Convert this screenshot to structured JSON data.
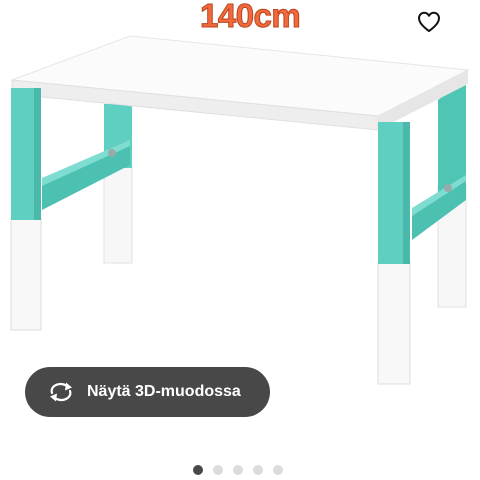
{
  "product": {
    "size_label": "140cm",
    "favorite_icon": "heart-outline-icon",
    "image_alt": "Desk with white top and turquoise adjustable legs"
  },
  "view3d": {
    "label": "Näytä 3D-muodossa",
    "icon": "rotate-arrows-icon"
  },
  "carousel": {
    "total": 5,
    "active_index": 0
  },
  "colors": {
    "accent_turquoise": "#5ecfc0",
    "button_bg": "#484848",
    "size_label": "#f26a3c"
  }
}
